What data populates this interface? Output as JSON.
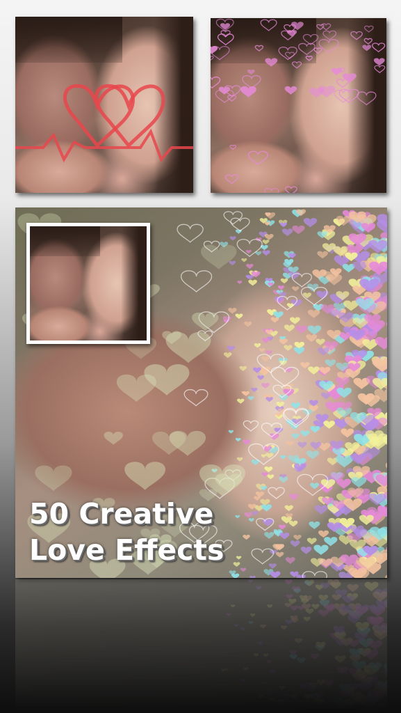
{
  "promo": {
    "title_line_1": "50 Creative",
    "title_line_2": "Love Effects"
  },
  "colors": {
    "heart_red": "#e8474c",
    "heart_pink": "#e68ad8",
    "heart_cyan": "#8fe3e8",
    "heart_peach": "#f4c3a0",
    "heart_yellow": "#f3f19a",
    "frame_white": "#ffffff"
  },
  "tiles": [
    {
      "effect": "heartbeat-hearts-icon"
    },
    {
      "effect": "purple-hearts-icon"
    },
    {
      "effect": "pastel-heart-trail-icon"
    }
  ]
}
